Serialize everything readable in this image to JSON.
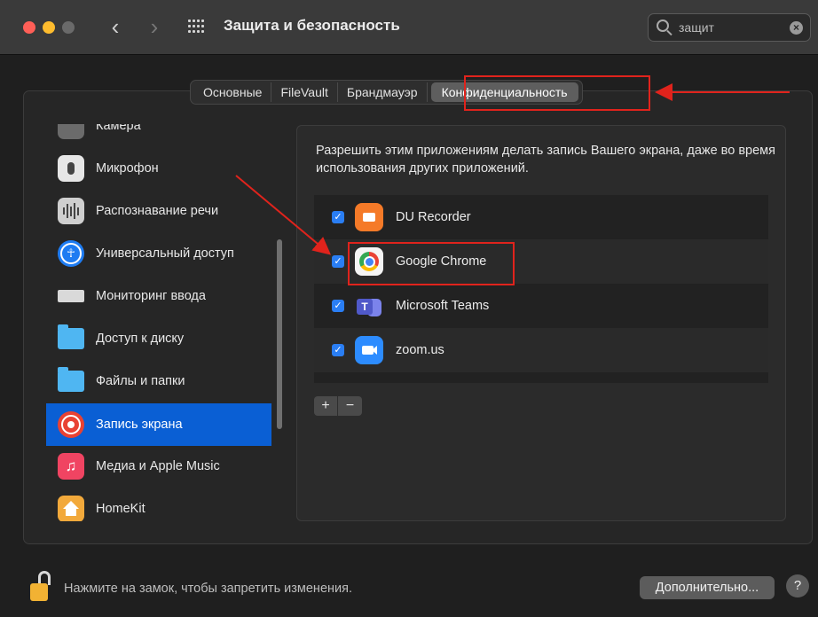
{
  "window": {
    "title": "Защита и безопасность",
    "search_value": "защит",
    "back_icon": "chevron-left-icon",
    "forward_icon": "chevron-right-icon",
    "grid_icon": "show-all-grid-icon",
    "search_icon": "magnifier-icon",
    "clear_icon": "clear-x-icon"
  },
  "tabs": [
    {
      "label": "Основные",
      "active": false
    },
    {
      "label": "FileVault",
      "active": false
    },
    {
      "label": "Брандмауэр",
      "active": false
    },
    {
      "label": "Конфиденциальность",
      "active": true
    }
  ],
  "sidebar": {
    "items": [
      {
        "label": "Камера",
        "icon": "camera-icon",
        "selected": false
      },
      {
        "label": "Микрофон",
        "icon": "microphone-icon",
        "selected": false
      },
      {
        "label": "Распознавание речи",
        "icon": "speech-recognition-icon",
        "selected": false
      },
      {
        "label": "Универсальный доступ",
        "icon": "accessibility-icon",
        "selected": false
      },
      {
        "label": "Мониторинг ввода",
        "icon": "keyboard-icon",
        "selected": false
      },
      {
        "label": "Доступ к диску",
        "icon": "folder-icon",
        "selected": false
      },
      {
        "label": "Файлы и папки",
        "icon": "folder-icon",
        "selected": false
      },
      {
        "label": "Запись экрана",
        "icon": "screen-recording-icon",
        "selected": true
      },
      {
        "label": "Медиа и Apple Music",
        "icon": "music-icon",
        "selected": false
      },
      {
        "label": "HomeKit",
        "icon": "home-icon",
        "selected": false
      }
    ]
  },
  "main": {
    "description": "Разрешить этим приложениям делать запись Вашего экрана, даже во время использования других приложений.",
    "apps": [
      {
        "name": "DU Recorder",
        "checked": true,
        "icon": "du-recorder-icon"
      },
      {
        "name": "Google Chrome",
        "checked": true,
        "icon": "chrome-icon"
      },
      {
        "name": "Microsoft Teams",
        "checked": true,
        "icon": "teams-icon"
      },
      {
        "name": "zoom.us",
        "checked": true,
        "icon": "zoom-icon"
      }
    ],
    "add_label": "+",
    "remove_label": "−"
  },
  "footer": {
    "lock_text": "Нажмите на замок, чтобы запретить изменения.",
    "advanced_label": "Дополнительно...",
    "help_label": "?"
  },
  "colors": {
    "accent": "#0a5fd4",
    "checkbox": "#2a7ef4",
    "annotation": "#e0231c"
  }
}
